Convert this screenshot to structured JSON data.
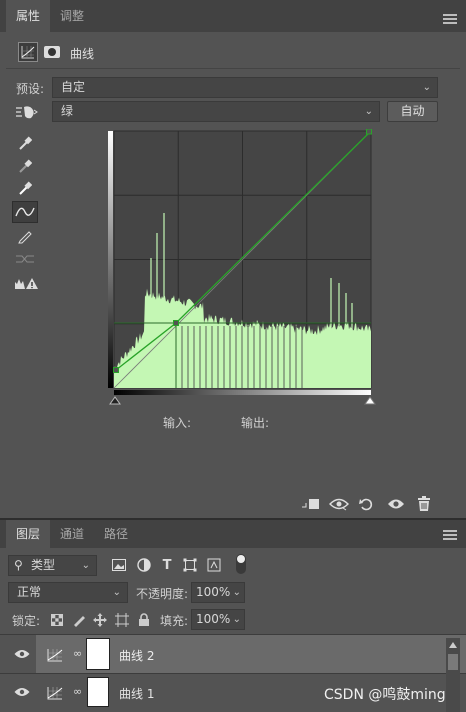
{
  "properties_panel": {
    "tabs": [
      "属性",
      "调整"
    ],
    "header_title": "曲线",
    "preset_label": "预设:",
    "preset_value": "自定",
    "channel_value": "绿",
    "auto_label": "自动",
    "input_label": "输入:",
    "output_label": "输出:",
    "curve_color": "#29a329",
    "histogram_color": "#c4f7b4"
  },
  "layers_panel": {
    "tabs": [
      "图层",
      "通道",
      "路径"
    ],
    "filter_label": "类型",
    "blend_mode": "正常",
    "opacity_label": "不透明度:",
    "opacity_value": "100%",
    "lock_label": "锁定:",
    "fill_label": "填充:",
    "fill_value": "100%",
    "layers": [
      {
        "name": "曲线 2",
        "selected": true
      },
      {
        "name": "曲线 1",
        "selected": false
      }
    ]
  },
  "watermark": "CSDN @鸣鼓ming"
}
